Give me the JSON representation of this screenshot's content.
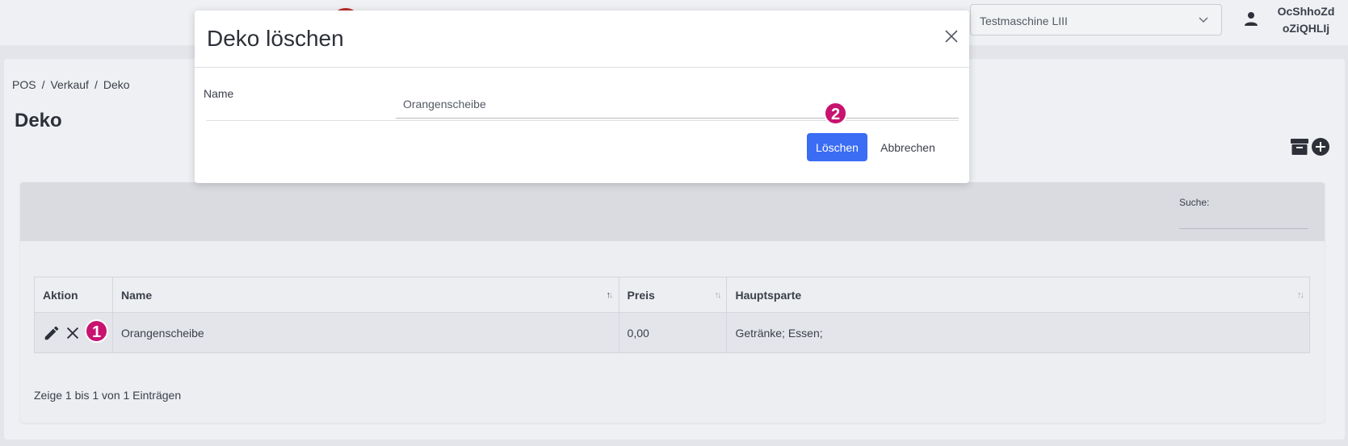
{
  "header": {
    "machine_select": "Testmaschine LIII",
    "user_name_line1": "OcShhoZd",
    "user_name_line2": "oZiQHLIj"
  },
  "breadcrumb": [
    "POS",
    "Verkauf",
    "Deko"
  ],
  "page_title": "Deko",
  "search": {
    "label": "Suche:"
  },
  "table": {
    "columns": [
      "Aktion",
      "Name",
      "Preis",
      "Hauptsparte"
    ],
    "rows": [
      {
        "name": "Orangenscheibe",
        "price": "0,00",
        "division": "Getränke; Essen;"
      }
    ]
  },
  "footer_info": "Zeige 1 bis 1 von 1 Einträgen",
  "markers": [
    "1",
    "2"
  ],
  "modal": {
    "title": "Deko löschen",
    "name_label": "Name",
    "name_value": "Orangenscheibe",
    "delete_label": "Löschen",
    "cancel_label": "Abbrechen"
  },
  "colors": {
    "primary": "#3a6cf4",
    "marker": "#c8136f"
  },
  "icons": [
    "user-icon",
    "chevron-down-icon",
    "archive-icon",
    "add-icon",
    "pencil-icon",
    "close-icon",
    "sort-icon"
  ]
}
